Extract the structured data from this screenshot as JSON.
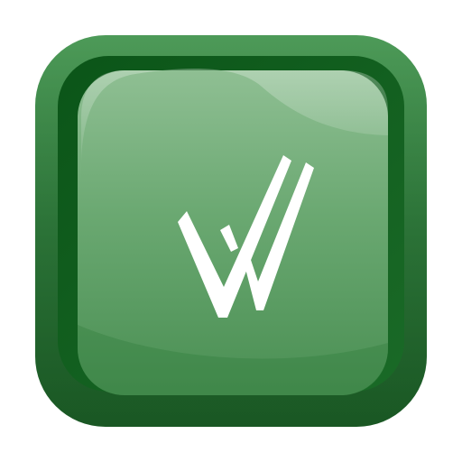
{
  "icon": {
    "kind": "app-icon",
    "shape": "rounded-square-button",
    "glyph": "double-check-mark-icon",
    "colors": {
      "outer_frame": "#2f7d3c",
      "outer_frame_dark": "#145e22",
      "inner_rim": "#0f5a1c",
      "face_top": "#8cbc8f",
      "face_bottom": "#4f9457",
      "glyph": "#ffffff",
      "background": "#ffffff"
    }
  }
}
